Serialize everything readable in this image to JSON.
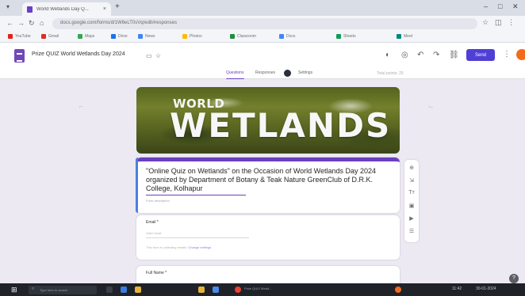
{
  "browser": {
    "tab_title": "World Wetlands Day Q...",
    "tab_close": "×",
    "new_tab": "+",
    "url": "docs.google.com/forms/d/1W6eLT0sVq/edit#responses",
    "bookmarks": [
      {
        "label": "YouTube",
        "color": "#e62117"
      },
      {
        "label": "Gmail",
        "color": "#d93025"
      },
      {
        "label": "Maps",
        "color": "#34a853"
      },
      {
        "label": "Drive",
        "color": "#1a73e8"
      },
      {
        "label": "News",
        "color": "#4285f4"
      },
      {
        "label": "Photos",
        "color": "#fbbc04"
      },
      {
        "label": "Classroom",
        "color": "#1e8e3e"
      },
      {
        "label": "Docs",
        "color": "#4285f4"
      },
      {
        "label": "Sheets",
        "color": "#0f9d58"
      },
      {
        "label": "Meet",
        "color": "#00897b"
      }
    ]
  },
  "header": {
    "doc_title": "Prize QUIZ World Wetlands Day 2024",
    "send_label": "Send",
    "tabs": [
      "Questions",
      "Responses",
      "Settings"
    ],
    "total_points": "Total points: 25"
  },
  "banner": {
    "line1": "WORLD",
    "line2": "WETLANDS"
  },
  "form": {
    "title": "\"Online Quiz on Wetlands\" on the Occasion of World Wetlands Day 2024 organized by Department of Botany & Teak Nature GreenClub of D.R.K. College, Kolhapur",
    "description": "Form description",
    "email_label": "Email *",
    "email_placeholder": "Valid email",
    "email_note": "This form is collecting emails.",
    "email_note_link": "Change settings",
    "name_label": "Full Name *"
  },
  "taskbar": {
    "search_placeholder": "Type here to search",
    "app_label": "Prize QUIZ World...",
    "tray_time": "11:42",
    "tray_date": "30-01-2024"
  },
  "colors": {
    "accent": "#6a3fc0",
    "send": "#4f3fd6",
    "avatar": "#f26b1d"
  }
}
